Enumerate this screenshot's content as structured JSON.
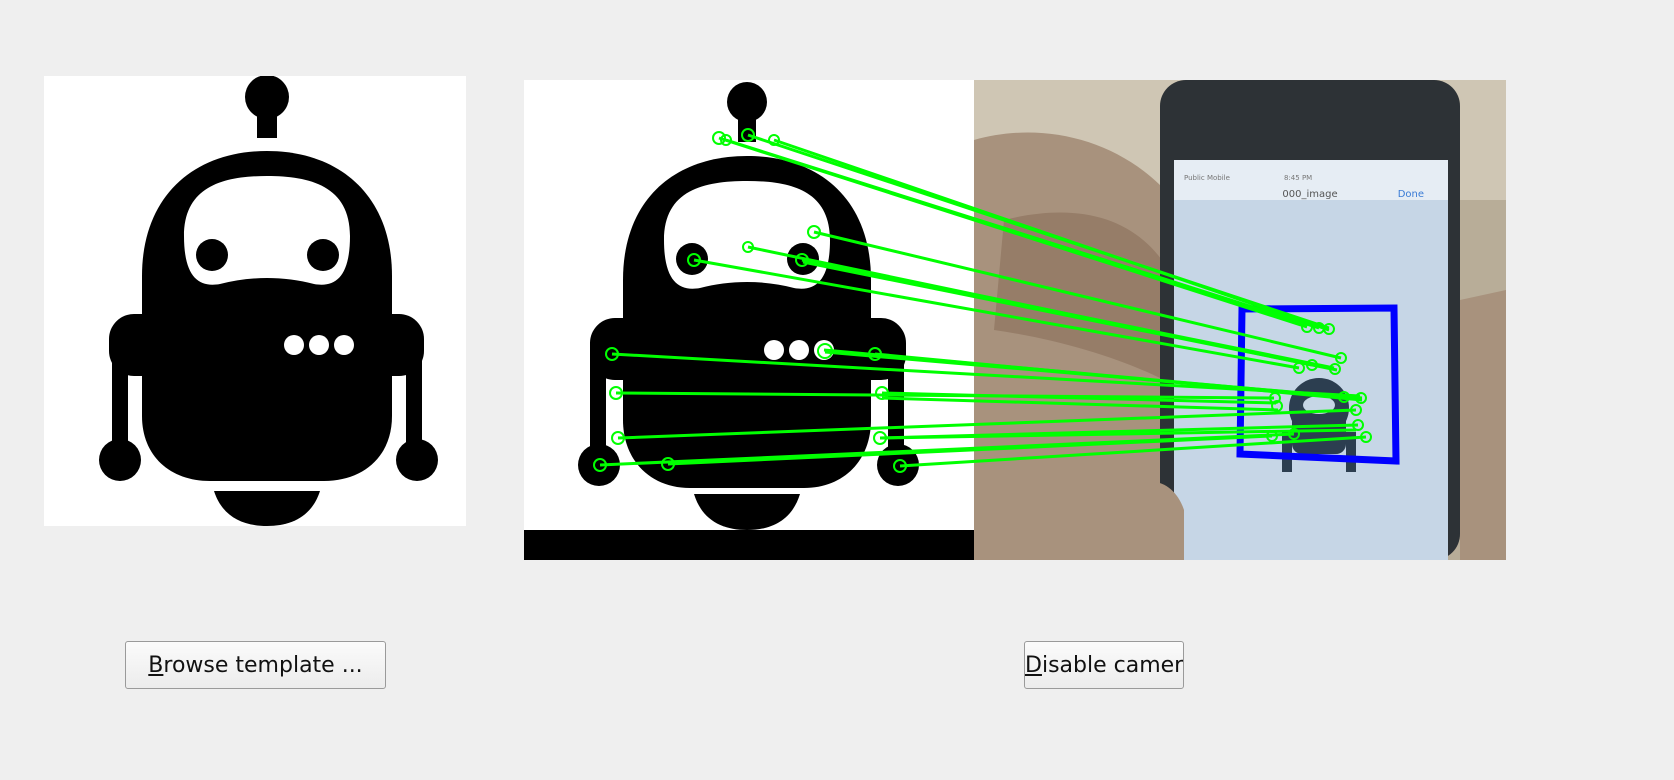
{
  "buttons": {
    "browse_mnemonic": "B",
    "browse_rest": "rowse template ...",
    "camera_mnemonic": "D",
    "camera_rest": "isable camera"
  },
  "phone_screen": {
    "title": "000_image",
    "done": "Done",
    "carrier": "Public Mobile",
    "time": "8:45 PM"
  },
  "colors": {
    "match_lines": "#00ff00",
    "detection_box": "#0000ff",
    "window_bg": "#efefef"
  }
}
